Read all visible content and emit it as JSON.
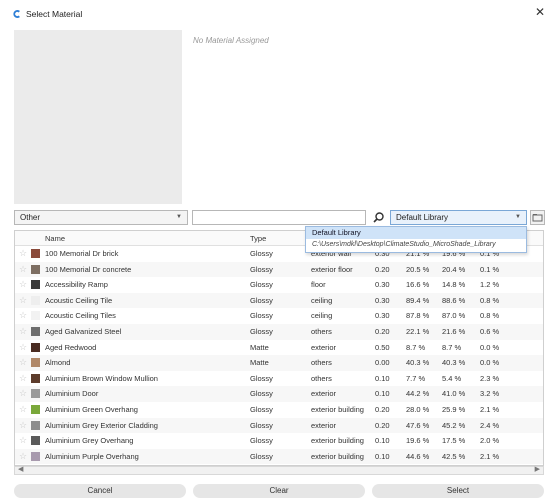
{
  "window": {
    "title": "Select Material",
    "close_glyph": "✕"
  },
  "preview": {
    "no_material_text": "No Material Assigned"
  },
  "filters": {
    "category_value": "Other",
    "search_value": "",
    "library_value": "Default Library"
  },
  "library_dropdown": {
    "items": [
      "Default Library",
      "C:\\Users\\mdkl\\Desktop\\ClimateStudio_MicroShade_Library"
    ]
  },
  "table": {
    "headers": {
      "name": "Name",
      "type": "Type"
    },
    "rows": [
      {
        "name": "100 Memorial Dr brick",
        "type": "Glossy",
        "category": "exterior wall",
        "v1": "0.30",
        "v2": "21.1 %",
        "v3": "19.6 %",
        "v4": "0.1 %",
        "color": "#8a4a3a"
      },
      {
        "name": "100 Memorial Dr concrete",
        "type": "Glossy",
        "category": "exterior floor",
        "v1": "0.20",
        "v2": "20.5 %",
        "v3": "20.4 %",
        "v4": "0.1 %",
        "color": "#7d6e62"
      },
      {
        "name": "Accessibility Ramp",
        "type": "Glossy",
        "category": "floor",
        "v1": "0.30",
        "v2": "16.6 %",
        "v3": "14.8 %",
        "v4": "1.2 %",
        "color": "#3b3b3b"
      },
      {
        "name": "Acoustic Ceiling Tile",
        "type": "Glossy",
        "category": "ceiling",
        "v1": "0.30",
        "v2": "89.4 %",
        "v3": "88.6 %",
        "v4": "0.8 %",
        "color": "#eeeeee"
      },
      {
        "name": "Acoustic Ceiling Tiles",
        "type": "Glossy",
        "category": "ceiling",
        "v1": "0.30",
        "v2": "87.8 %",
        "v3": "87.0 %",
        "v4": "0.8 %",
        "color": "#f2f2f2"
      },
      {
        "name": "Aged Galvanized Steel",
        "type": "Glossy",
        "category": "others",
        "v1": "0.20",
        "v2": "22.1 %",
        "v3": "21.6 %",
        "v4": "0.6 %",
        "color": "#6e6e6e"
      },
      {
        "name": "Aged Redwood",
        "type": "Matte",
        "category": "exterior",
        "v1": "0.50",
        "v2": "8.7 %",
        "v3": "8.7 %",
        "v4": "0.0 %",
        "color": "#4a2c22"
      },
      {
        "name": "Almond",
        "type": "Matte",
        "category": "others",
        "v1": "0.00",
        "v2": "40.3 %",
        "v3": "40.3 %",
        "v4": "0.0 %",
        "color": "#b08868"
      },
      {
        "name": "Aluminium Brown Window Mullion",
        "type": "Glossy",
        "category": "others",
        "v1": "0.10",
        "v2": "7.7 %",
        "v3": "5.4 %",
        "v4": "2.3 %",
        "color": "#5c3b2a"
      },
      {
        "name": "Aluminium Door",
        "type": "Glossy",
        "category": "exterior",
        "v1": "0.10",
        "v2": "44.2 %",
        "v3": "41.0 %",
        "v4": "3.2 %",
        "color": "#9a9a9a"
      },
      {
        "name": "Aluminium Green Overhang",
        "type": "Glossy",
        "category": "exterior building",
        "v1": "0.20",
        "v2": "28.0 %",
        "v3": "25.9 %",
        "v4": "2.1 %",
        "color": "#7aa83a"
      },
      {
        "name": "Aluminium Grey Exterior Cladding",
        "type": "Glossy",
        "category": "exterior",
        "v1": "0.20",
        "v2": "47.6 %",
        "v3": "45.2 %",
        "v4": "2.4 %",
        "color": "#8c8c8c"
      },
      {
        "name": "Aluminium Grey Overhang",
        "type": "Glossy",
        "category": "exterior building",
        "v1": "0.10",
        "v2": "19.6 %",
        "v3": "17.5 %",
        "v4": "2.0 %",
        "color": "#5a5a5a"
      },
      {
        "name": "Aluminium Purple Overhang",
        "type": "Glossy",
        "category": "exterior building",
        "v1": "0.10",
        "v2": "44.6 %",
        "v3": "42.5 %",
        "v4": "2.1 %",
        "color": "#a89aae"
      }
    ]
  },
  "buttons": {
    "cancel": "Cancel",
    "clear": "Clear",
    "select": "Select"
  },
  "colors": {
    "accent": "#2f7fd6",
    "selection": "#cfe3f8"
  }
}
